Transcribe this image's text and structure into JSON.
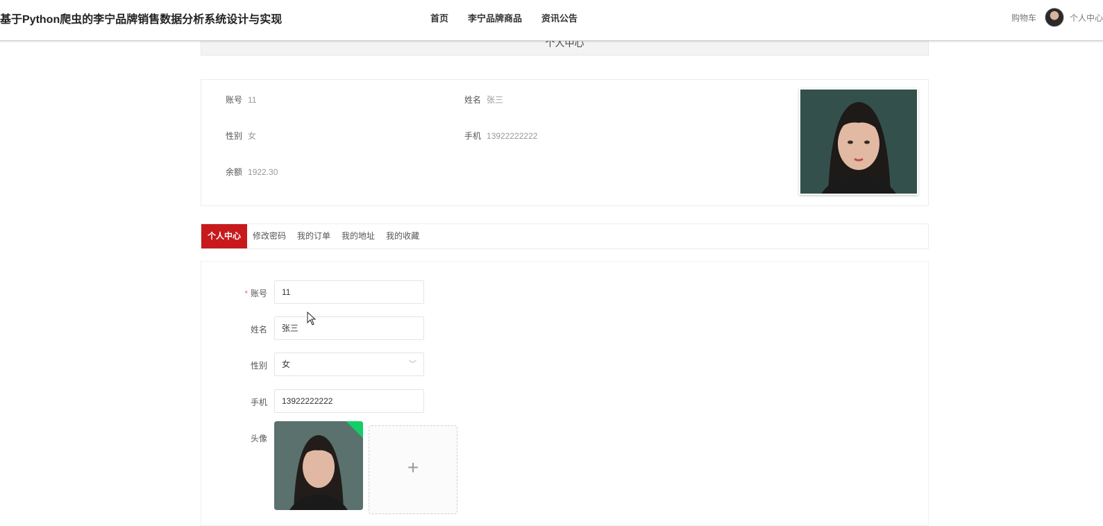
{
  "header": {
    "site_title": "基于Python爬虫的李宁品牌销售数据分析系统设计与实现",
    "nav": [
      "首页",
      "李宁品牌商品",
      "资讯公告"
    ],
    "cart_label": "购物车",
    "user_center_label": "个人中心"
  },
  "page_title": "个人中心",
  "profile": {
    "account_label": "账号",
    "account_value": "11",
    "name_label": "姓名",
    "name_value": "张三",
    "gender_label": "性别",
    "gender_value": "女",
    "phone_label": "手机",
    "phone_value": "13922222222",
    "balance_label": "余额",
    "balance_value": "1922.30"
  },
  "tabs": [
    "个人中心",
    "修改密码",
    "我的订单",
    "我的地址",
    "我的收藏"
  ],
  "form": {
    "account_label": "账号",
    "account_value": "11",
    "name_label": "姓名",
    "name_value": "张三",
    "gender_label": "性别",
    "gender_value": "女",
    "phone_label": "手机",
    "phone_value": "13922222222",
    "avatar_label": "头像",
    "upload_plus": "+"
  },
  "colors": {
    "accent": "#c8191c",
    "success": "#13ce66",
    "required": "#f56c6c"
  }
}
